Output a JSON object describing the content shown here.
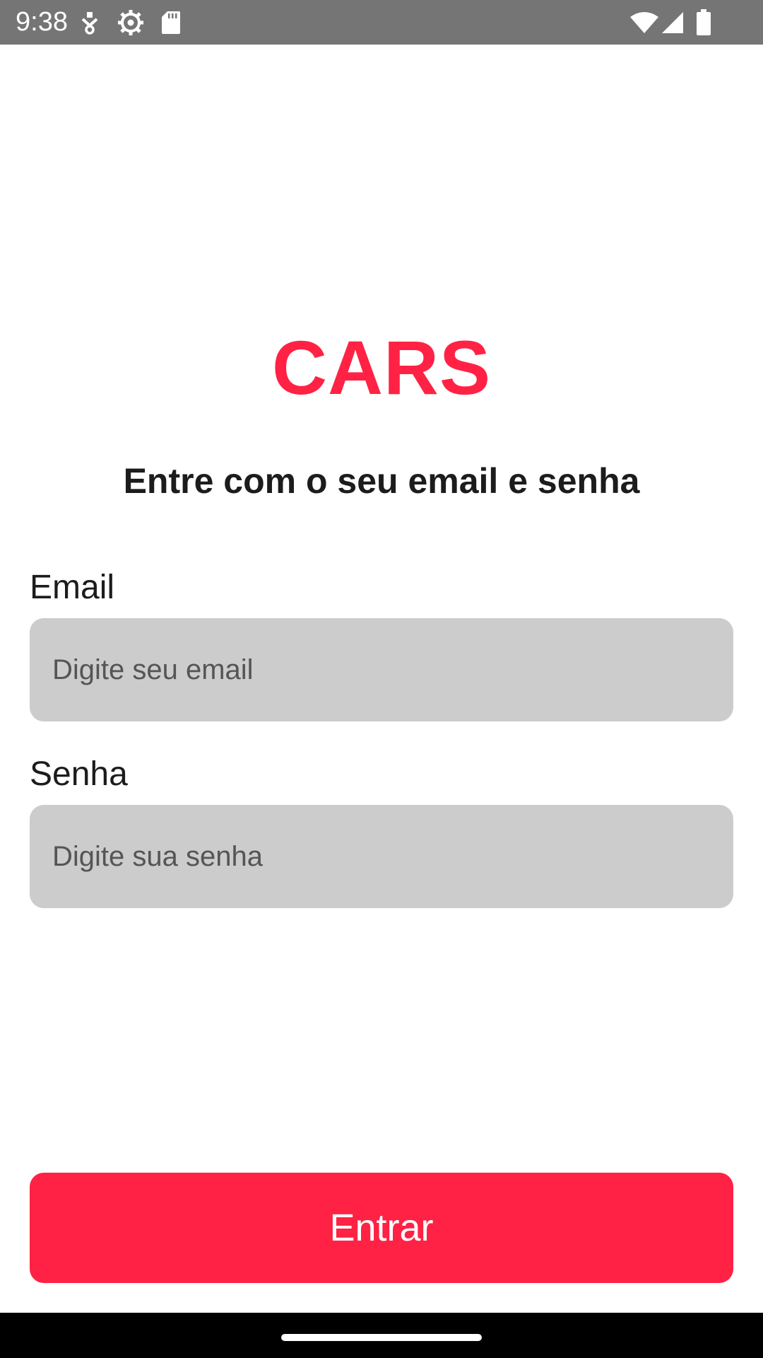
{
  "status_bar": {
    "time": "9:38",
    "icons_left": [
      "download-icon",
      "settings-icon",
      "sd-card-icon"
    ],
    "icons_right": [
      "wifi-icon",
      "signal-icon",
      "battery-icon"
    ]
  },
  "app": {
    "title": "CARS",
    "subtitle": "Entre com o seu email e senha"
  },
  "form": {
    "email_label": "Email",
    "email_placeholder": "Digite seu email",
    "email_value": "",
    "password_label": "Senha",
    "password_placeholder": "Digite sua senha",
    "password_value": "",
    "submit_label": "Entrar"
  },
  "colors": {
    "accent": "#ff2244",
    "input_background": "#cccccc",
    "status_bar": "#757575",
    "nav_bar": "#000000"
  }
}
